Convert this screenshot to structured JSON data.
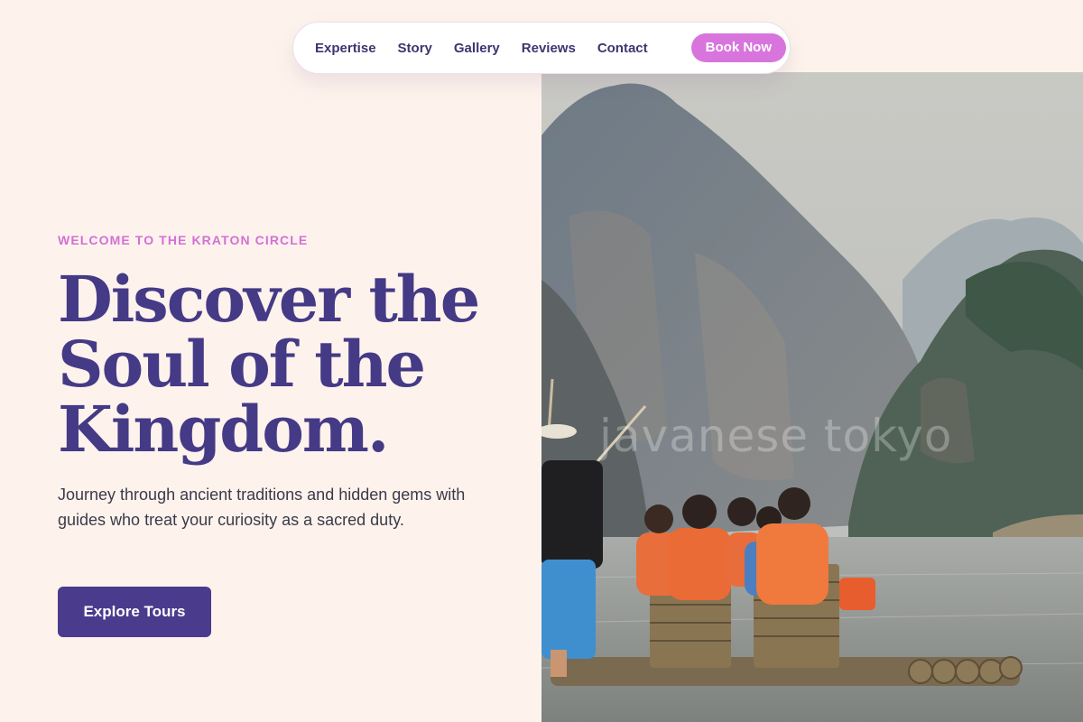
{
  "nav": {
    "links": [
      "Expertise",
      "Story",
      "Gallery",
      "Reviews",
      "Contact"
    ],
    "cta_label": "Book Now"
  },
  "hero": {
    "eyebrow": "WELCOME TO THE KRATON CIRCLE",
    "headline_lines": [
      "Discover the",
      "Soul of the",
      "Kingdom."
    ],
    "lead": "Journey through ancient traditions and hidden gems with guides who treat your curiosity as a sacred duty.",
    "cta_label": "Explore Tours",
    "image_watermark": "javanese tokyo"
  },
  "colors": {
    "background": "#fdf3ec",
    "primary": "#453a86",
    "accent": "#d875dd",
    "text": "#3b3a4a"
  }
}
